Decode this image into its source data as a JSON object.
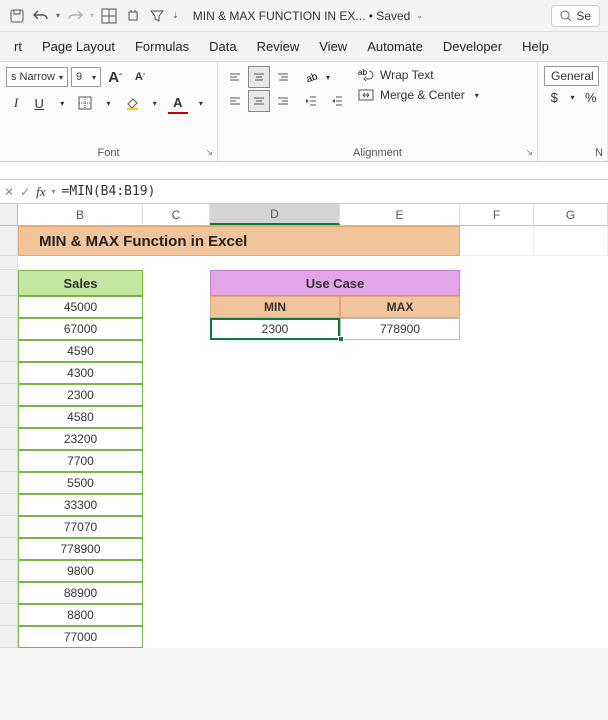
{
  "titlebar": {
    "doc_name": "MIN & MAX FUNCTION IN EX... • Saved",
    "search_placeholder": "Se"
  },
  "tabs": {
    "rt": "rt",
    "pagelayout": "Page Layout",
    "formulas": "Formulas",
    "data": "Data",
    "review": "Review",
    "view": "View",
    "automate": "Automate",
    "developer": "Developer",
    "help": "Help"
  },
  "ribbon": {
    "font_name": "s Narrow",
    "font_size": "9",
    "font_group": "Font",
    "align_group": "Alignment",
    "wrap_label": "Wrap Text",
    "merge_label": "Merge & Center",
    "number_format": "General",
    "number_group": "N"
  },
  "formula": {
    "fx": "fx",
    "value": "=MIN(B4:B19)"
  },
  "columns": {
    "B": "B",
    "C": "C",
    "D": "D",
    "E": "E",
    "F": "F",
    "G": "G"
  },
  "sheet": {
    "title": "MIN & MAX Function in Excel",
    "sales_header": "Sales",
    "usecase_header": "Use Case",
    "min_label": "MIN",
    "max_label": "MAX",
    "min_value": "2300",
    "max_value": "778900",
    "sales": [
      "45000",
      "67000",
      "4590",
      "4300",
      "2300",
      "4580",
      "23200",
      "7700",
      "5500",
      "33300",
      "77070",
      "778900",
      "9800",
      "88900",
      "8800",
      "77000"
    ]
  },
  "chart_data": {
    "type": "table",
    "title": "MIN & MAX Function in Excel",
    "columns": [
      "Sales"
    ],
    "values": [
      45000,
      67000,
      4590,
      4300,
      2300,
      4580,
      23200,
      7700,
      5500,
      33300,
      77070,
      778900,
      9800,
      88900,
      8800,
      77000
    ],
    "summary": {
      "MIN": 2300,
      "MAX": 778900
    }
  }
}
